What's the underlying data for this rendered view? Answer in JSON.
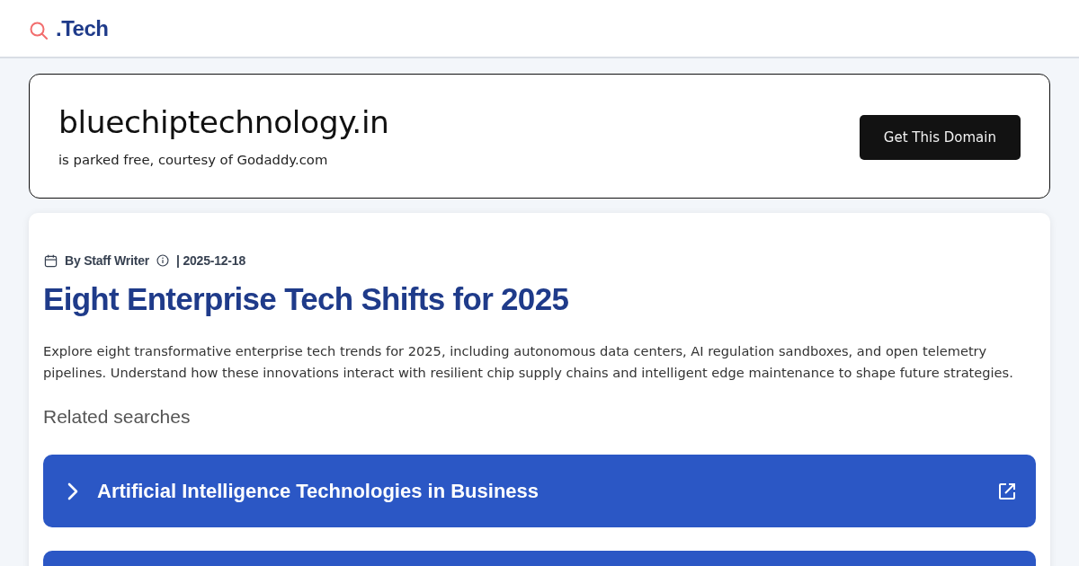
{
  "header": {
    "logo_text": ".Tech"
  },
  "domain_banner": {
    "domain": "bluechiptechnology.in",
    "subtitle": "is parked free, courtesy of Godaddy.com",
    "button": "Get This Domain"
  },
  "article": {
    "author": "By Staff Writer",
    "date": "| 2025-12-18",
    "title": "Eight Enterprise Tech Shifts for 2025",
    "description": "Explore eight transformative enterprise tech trends for 2025, including autonomous data centers, AI regulation sandboxes, and open telemetry pipelines. Understand how these innovations interact with resilient chip supply chains and intelligent edge maintenance to shape future strategies."
  },
  "related_searches": {
    "heading": "Related searches",
    "items": [
      {
        "kind": "full",
        "label": "Artificial Intelligence Technologies in Business"
      },
      {
        "kind": "cut"
      }
    ]
  }
}
